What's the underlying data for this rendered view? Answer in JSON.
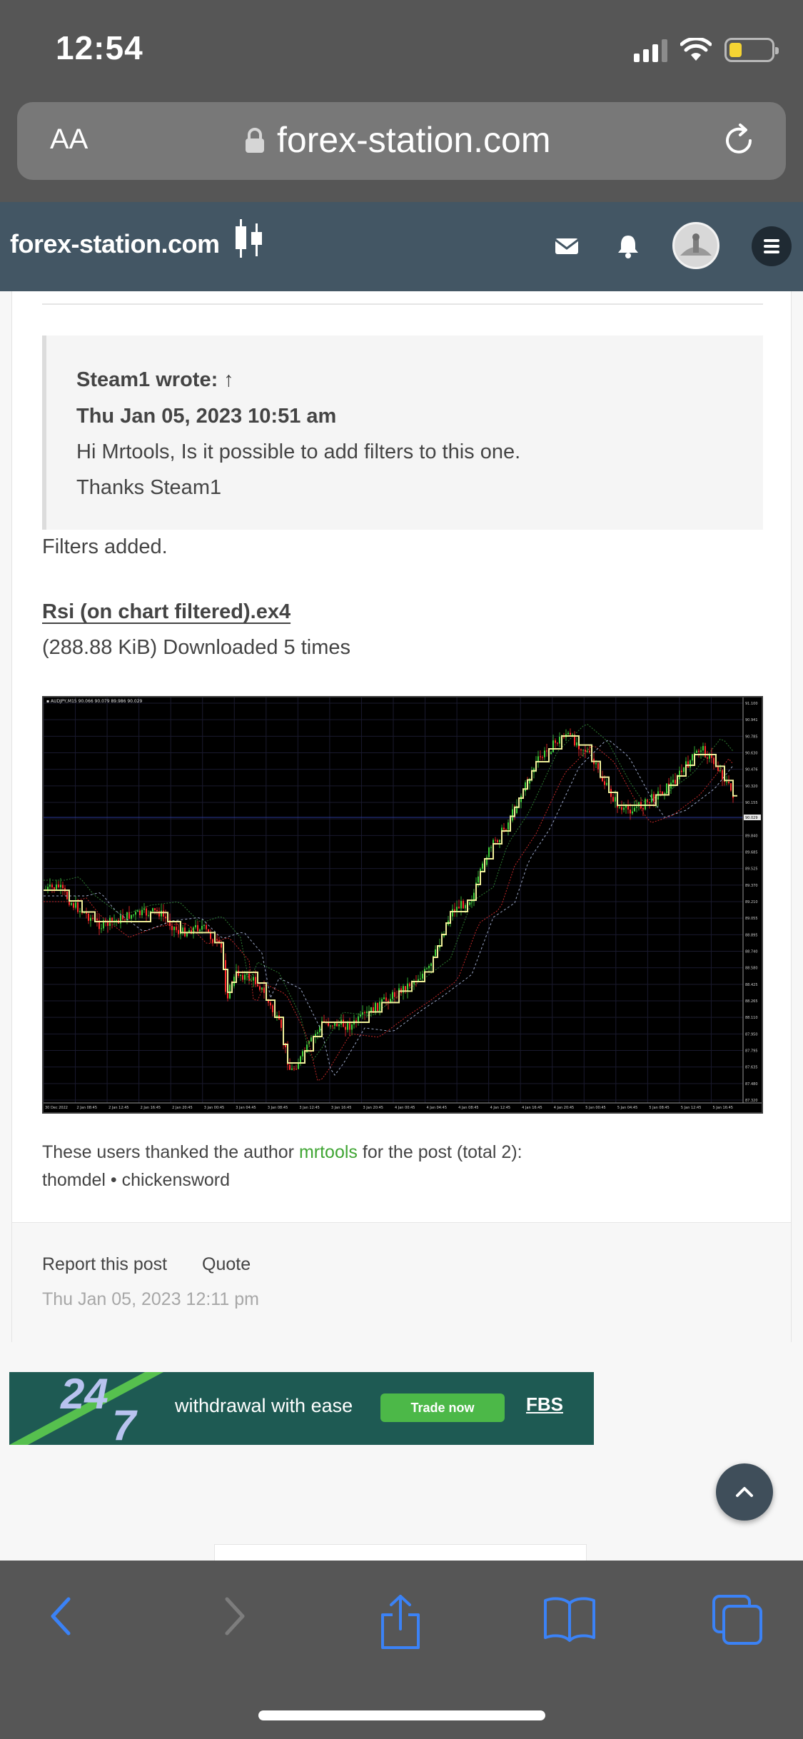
{
  "status_bar": {
    "time": "12:54"
  },
  "browser": {
    "text_size_label": "AA",
    "url": "forex-station.com"
  },
  "site": {
    "logo_text": "forex-station.com"
  },
  "post": {
    "quote": {
      "author": "Steam1 wrote: ↑",
      "date": "Thu Jan 05, 2023 10:51 am",
      "line1": "Hi Mrtools, Is it possible to add filters to this one.",
      "line2": "Thanks Steam1"
    },
    "body": "Filters added.",
    "attachment": {
      "name": "Rsi (on chart filtered).ex4",
      "info": "(288.88 KiB) Downloaded 5 times"
    },
    "chart": {
      "symbol_line": "▪ AUDJPY,M15  90.066 90.079 89.986 90.029",
      "price_ticks": [
        "91.100",
        "90.941",
        "90.785",
        "90.630",
        "90.476",
        "90.320",
        "90.155",
        "89.995",
        "89.840",
        "89.685",
        "89.525",
        "89.370",
        "89.210",
        "89.055",
        "88.895",
        "88.740",
        "88.580",
        "88.425",
        "88.265",
        "88.110",
        "87.950",
        "87.795",
        "87.635",
        "87.480",
        "87.320"
      ],
      "current_price": "90.029",
      "time_ticks": [
        "30 Dec 2022",
        "2 Jan 08:45",
        "2 Jan 12:45",
        "2 Jan 16:45",
        "2 Jan 20:45",
        "3 Jan 00:45",
        "3 Jan 04:45",
        "3 Jan 08:45",
        "3 Jan 12:45",
        "3 Jan 16:45",
        "3 Jan 20:45",
        "4 Jan 00:45",
        "4 Jan 04:45",
        "4 Jan 08:45",
        "4 Jan 12:45",
        "4 Jan 16:45",
        "4 Jan 20:45",
        "5 Jan 00:45",
        "5 Jan 04:45",
        "5 Jan 08:45",
        "5 Jan 12:45",
        "5 Jan 16:45"
      ]
    },
    "thanks": {
      "prefix": "These users thanked the author ",
      "author": "mrtools",
      "suffix": " for the post (total 2):",
      "users": "thomdel • chickensword"
    },
    "footer": {
      "report": "Report this post",
      "quote": "Quote",
      "date": "Thu Jan 05, 2023 12:11 pm"
    }
  },
  "ad": {
    "big_a": "24",
    "big_b": "7",
    "tagline": "withdrawal with ease",
    "button": "Trade now",
    "brand": "FBS"
  },
  "colors": {
    "header_bg": "#435664",
    "browser_chrome": "#565656",
    "link_green": "#3fa533",
    "ios_blue": "#3b82f6"
  }
}
